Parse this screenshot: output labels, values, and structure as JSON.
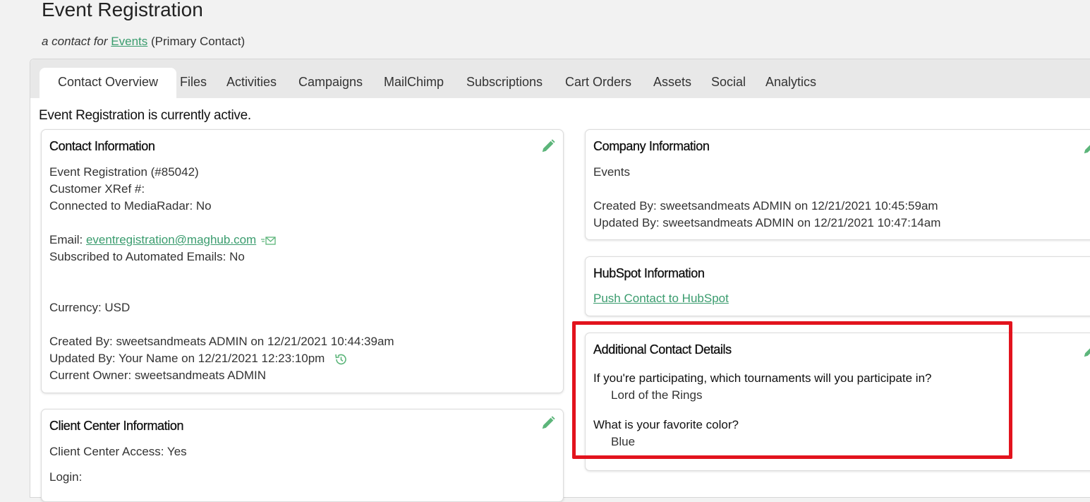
{
  "header": {
    "title": "Event Registration",
    "subtitle_prefix": "a contact for",
    "subtitle_link": "Events",
    "subtitle_suffix": "(Primary Contact)"
  },
  "tabs": [
    {
      "label": "Contact Overview",
      "active": true
    },
    {
      "label": "Files"
    },
    {
      "label": "Activities"
    },
    {
      "label": "Campaigns"
    },
    {
      "label": "MailChimp"
    },
    {
      "label": "Subscriptions"
    },
    {
      "label": "Cart Orders"
    },
    {
      "label": "Assets"
    },
    {
      "label": "Social"
    },
    {
      "label": "Analytics"
    }
  ],
  "status": "Event Registration is currently active.",
  "contact_info": {
    "title": "Contact Information",
    "name": "Event Registration (#85042)",
    "xref": "Customer XRef #:",
    "mediaradar": "Connected to MediaRadar: No",
    "email_label": "Email:",
    "email": "eventregistration@maghub.com",
    "subscribed": "Subscribed to Automated Emails: No",
    "currency": "Currency: USD",
    "created": "Created By: sweetsandmeats ADMIN on 12/21/2021 10:44:39am",
    "updated": "Updated By: Your Name on 12/21/2021 12:23:10pm",
    "owner": "Current Owner: sweetsandmeats ADMIN"
  },
  "client_center": {
    "title": "Client Center Information",
    "access": "Client Center Access: Yes",
    "login": "Login:"
  },
  "company_info": {
    "title": "Company Information",
    "company": "Events",
    "created": "Created By: sweetsandmeats ADMIN on 12/21/2021 10:45:59am",
    "updated": "Updated By: sweetsandmeats ADMIN on 12/21/2021 10:47:14am"
  },
  "hubspot": {
    "title": "HubSpot Information",
    "push_link": "Push Contact to HubSpot"
  },
  "additional": {
    "title": "Additional Contact Details",
    "q1": "If you're participating, which tournaments will you participate in?",
    "a1": "Lord of the Rings",
    "q2": "What is your favorite color?",
    "a2": "Blue"
  },
  "colors": {
    "accent": "#3a9c6e",
    "highlight": "#e2131d",
    "pencil": "#5cb57a"
  },
  "icons": [
    "pencil-icon",
    "email-icon",
    "history-icon"
  ]
}
